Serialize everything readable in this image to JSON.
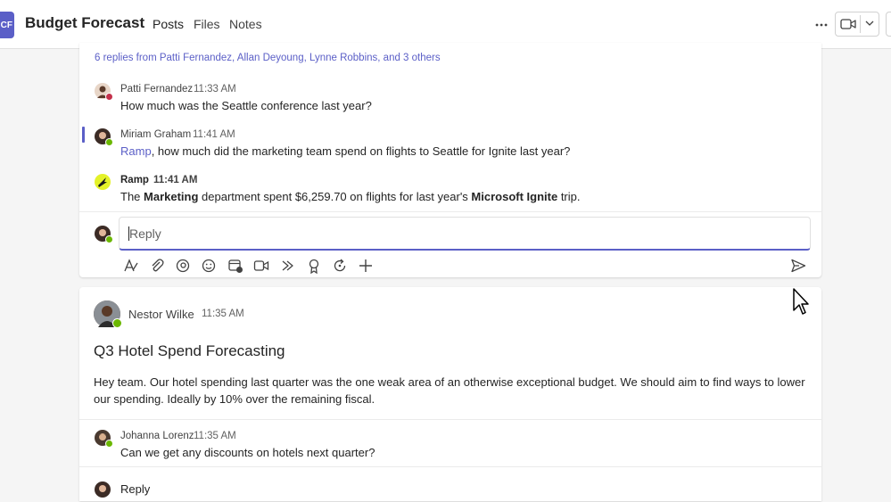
{
  "header": {
    "team_initials": "CF",
    "team_name": "Budget Forecast",
    "tabs": [
      {
        "label": "Posts",
        "active": true
      },
      {
        "label": "Files",
        "active": false
      },
      {
        "label": "Notes",
        "active": false
      }
    ],
    "more_icon": "more-icon",
    "meet_icon": "video-icon"
  },
  "thread1": {
    "replies_summary": "6 replies from Patti Fernandez, Allan Deyoung, Lynne Robbins, and 3 others",
    "messages": [
      {
        "author": "Patti Fernandez",
        "time": "11:33 AM",
        "text": "How much was the Seattle conference last year?",
        "presence": "busy"
      },
      {
        "author": "Miriam Graham",
        "time": "11:41 AM",
        "mention": "Ramp",
        "text": ", how much did the marketing team spend on flights to Seattle for Ignite last year?",
        "presence": "available"
      },
      {
        "author": "Ramp",
        "time": "11:41 AM",
        "text_parts": [
          "The ",
          "Marketing",
          " department spent $6,259.70 on flights for last year's ",
          "Microsoft Ignite",
          " trip."
        ]
      }
    ],
    "reply_placeholder": "Reply",
    "toolbar_icons": [
      "format-icon",
      "attach-icon",
      "loop-icon",
      "emoji-icon",
      "schedule-icon",
      "video-clip-icon",
      "stream-icon",
      "praise-icon",
      "refresh-icon",
      "add-icon"
    ],
    "send_icon": "send-icon"
  },
  "thread2": {
    "author": "Nestor Wilke",
    "time": "11:35 AM",
    "title": "Q3 Hotel Spend Forecasting",
    "body": "Hey team. Our hotel spending last quarter was the one weak area of an otherwise exceptional budget. We should aim to find ways to lower our spending. Ideally by 10% over the remaining fiscal.",
    "reply": {
      "author": "Johanna Lorenz",
      "time": "11:35 AM",
      "text": "Can we get any discounts on hotels next quarter?"
    },
    "reply_link": "Reply"
  },
  "colors": {
    "accent": "#5b5fc7",
    "available": "#6bb700",
    "busy": "#c4314b"
  }
}
